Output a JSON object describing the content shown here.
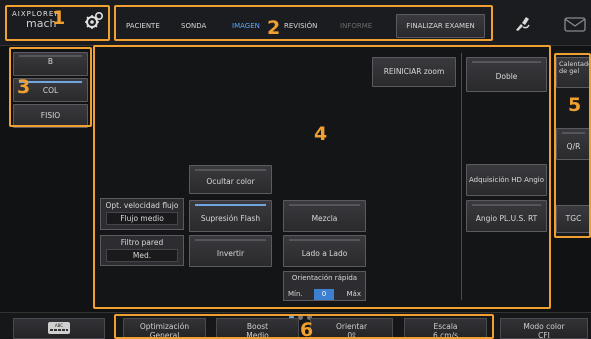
{
  "brand": {
    "line1": "AIXPLORER",
    "line2": "mach"
  },
  "nav": {
    "tabs": [
      {
        "label": "PACIENTE"
      },
      {
        "label": "SONDA"
      },
      {
        "label": "IMAGEN"
      },
      {
        "label": "REVISIÓN"
      },
      {
        "label": "INFORME"
      }
    ],
    "finish_label": "FINALIZAR EXAMEN"
  },
  "modes": {
    "items": [
      "B",
      "COL",
      "FISIO"
    ]
  },
  "main": {
    "reset_zoom": "REINICIAR zoom",
    "hide_color": "Ocultar color",
    "flow_opt_title": "Opt. velocidad flujo",
    "flow_opt_value": "Flujo medio",
    "flash_suppression": "Supresión Flash",
    "mix": "Mezcla",
    "wall_filter_title": "Filtro pared",
    "wall_filter_value": "Med.",
    "invert": "Invertir",
    "side_by_side": "Lado a Lado",
    "quick_orient_title": "Orientación rápida",
    "quick_orient_min": "Mín.",
    "quick_orient_value": "0",
    "quick_orient_max": "Máx"
  },
  "right_column": {
    "double": "Doble",
    "hd_angio": "Adquisición HD Angio",
    "angio_plus": "Angio PL.U.S. RT"
  },
  "side_panel": {
    "gel_warmer": "Calentador de gel",
    "qr": "Q/R",
    "tgc": "TGC"
  },
  "bottom": {
    "keyboard_label": "ABC",
    "buttons": [
      {
        "line1": "Optimización",
        "line2": "General"
      },
      {
        "line1": "Boost",
        "line2": "Medio"
      },
      {
        "line1": "Orientar",
        "line2": "0º"
      },
      {
        "line1": "Escala",
        "line2": "6 cm/s"
      },
      {
        "line1": "Modo color",
        "line2": "CFI"
      }
    ]
  },
  "callouts": [
    "1",
    "2",
    "3",
    "4",
    "5",
    "6"
  ],
  "colors": {
    "accent": "#f0a030",
    "active_tab": "#59a8ff"
  }
}
